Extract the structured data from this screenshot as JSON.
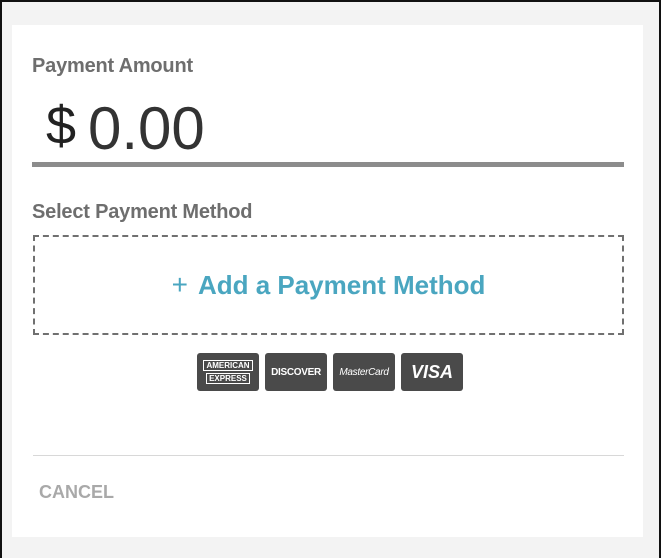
{
  "payment_amount": {
    "label": "Payment Amount",
    "currency_symbol": "$",
    "value": "0.00"
  },
  "payment_method": {
    "label": "Select Payment Method",
    "add_label": "Add a Payment Method",
    "add_icon": "+"
  },
  "accepted_cards": [
    {
      "name": "amex-icon",
      "line1": "AMERICAN",
      "line2": "EXPRESS"
    },
    {
      "name": "discover-icon",
      "text": "DISCOVER"
    },
    {
      "name": "mastercard-icon",
      "text": "MasterCard"
    },
    {
      "name": "visa-icon",
      "text": "VISA"
    }
  ],
  "actions": {
    "cancel_label": "CANCEL"
  },
  "colors": {
    "accent": "#4aa6c0",
    "label": "#6e6e6e",
    "card_bg": "#4a4a4a",
    "underline": "#8c8c8c"
  }
}
